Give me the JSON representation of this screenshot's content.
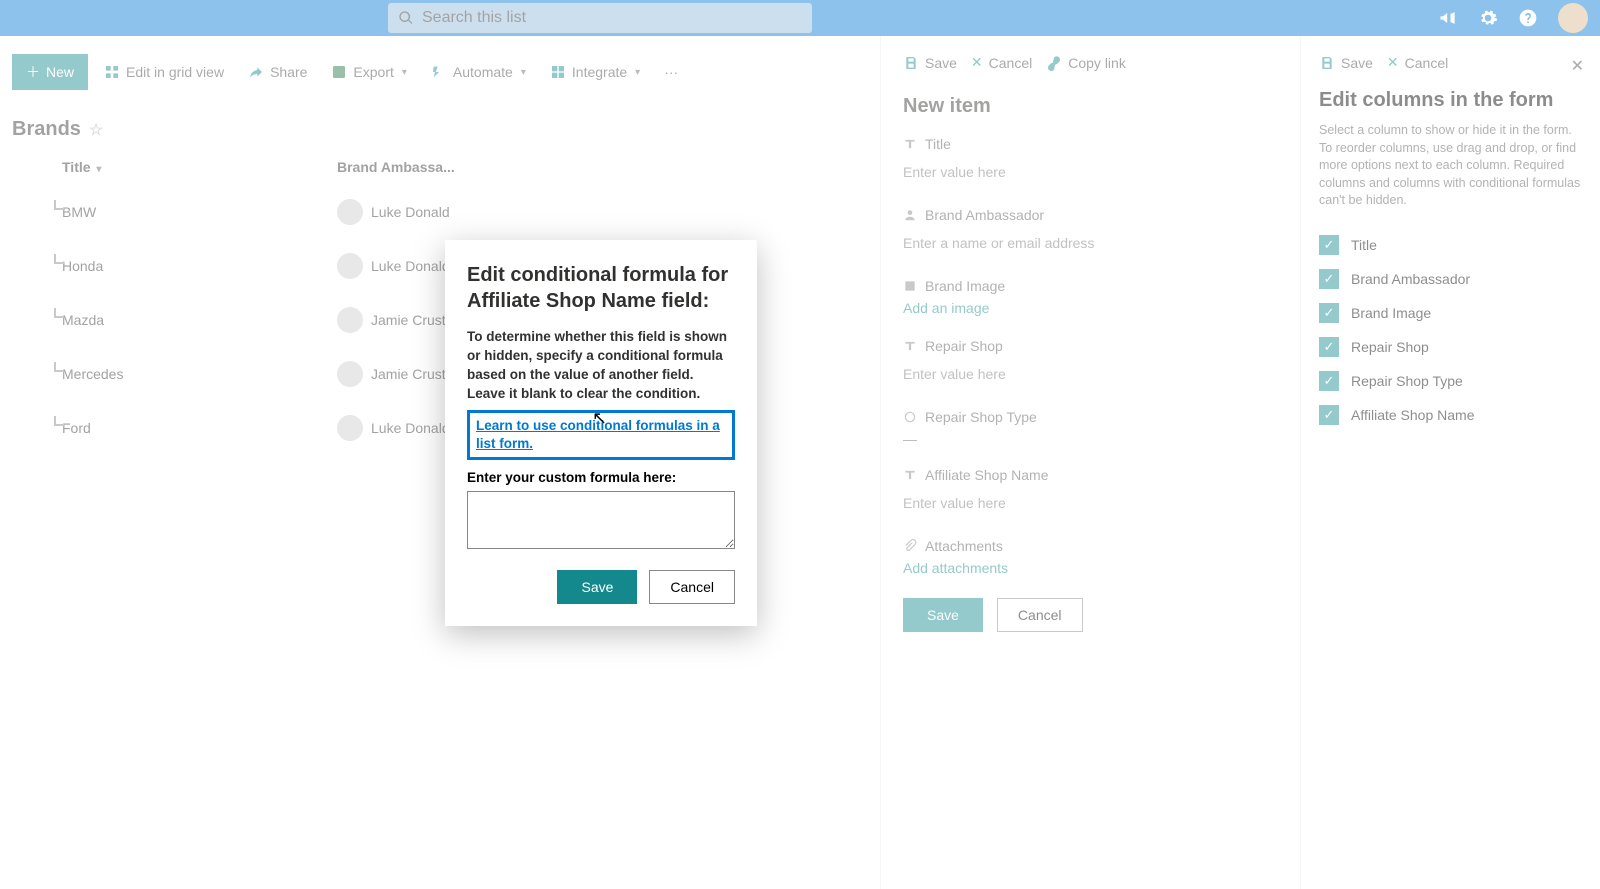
{
  "topbar": {
    "search_placeholder": "Search this list"
  },
  "cmdbar": {
    "new": "New",
    "grid": "Edit in grid view",
    "share": "Share",
    "export": "Export",
    "automate": "Automate",
    "integrate": "Integrate"
  },
  "list": {
    "title": "Brands",
    "columns": {
      "title": "Title",
      "ambassador": "Brand Ambassa..."
    },
    "rows": [
      {
        "title": "BMW",
        "ambassador": "Luke Donald"
      },
      {
        "title": "Honda",
        "ambassador": "Luke Donald"
      },
      {
        "title": "Mazda",
        "ambassador": "Jamie Crust"
      },
      {
        "title": "Mercedes",
        "ambassador": "Jamie Crust"
      },
      {
        "title": "Ford",
        "ambassador": "Luke Donald"
      }
    ]
  },
  "form_panel": {
    "save": "Save",
    "cancel": "Cancel",
    "copylink": "Copy link",
    "heading": "New item",
    "fields": {
      "title": {
        "label": "Title",
        "placeholder": "Enter value here"
      },
      "ambassador": {
        "label": "Brand Ambassador",
        "placeholder": "Enter a name or email address"
      },
      "image": {
        "label": "Brand Image",
        "action": "Add an image"
      },
      "repair_shop": {
        "label": "Repair Shop",
        "placeholder": "Enter value here"
      },
      "repair_type": {
        "label": "Repair Shop Type",
        "value": "—"
      },
      "affiliate": {
        "label": "Affiliate Shop Name",
        "placeholder": "Enter value here"
      },
      "attachments": {
        "label": "Attachments",
        "action": "Add attachments"
      }
    },
    "btn_save": "Save",
    "btn_cancel": "Cancel"
  },
  "cols_panel": {
    "save": "Save",
    "cancel": "Cancel",
    "heading": "Edit columns in the form",
    "desc": "Select a column to show or hide it in the form. To reorder columns, use drag and drop, or find more options next to each column. Required columns and columns with conditional formulas can't be hidden.",
    "items": [
      "Title",
      "Brand Ambassador",
      "Brand Image",
      "Repair Shop",
      "Repair Shop Type",
      "Affiliate Shop Name"
    ]
  },
  "modal": {
    "title": "Edit conditional formula for Affiliate Shop Name field:",
    "body": "To determine whether this field is shown or hidden, specify a conditional formula based on the value of another field. Leave it blank to clear the condition.",
    "learn": "Learn to use conditional formulas in a list form.",
    "label": "Enter your custom formula here:",
    "save": "Save",
    "cancel": "Cancel"
  }
}
